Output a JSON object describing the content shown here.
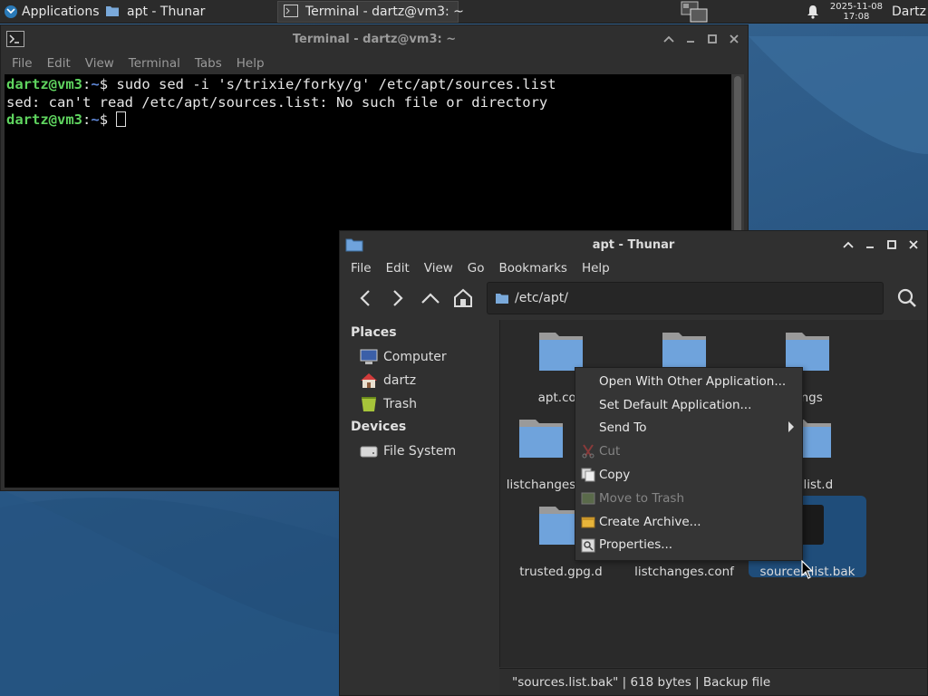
{
  "panel": {
    "applications_label": "Applications",
    "tasks": [
      {
        "label": "apt - Thunar"
      },
      {
        "label": "Terminal - dartz@vm3: ~"
      }
    ],
    "clock_date": "2025-11-08",
    "clock_time": "17:08",
    "user": "Dartz"
  },
  "terminal": {
    "title": "Terminal - dartz@vm3: ~",
    "menu": [
      "File",
      "Edit",
      "View",
      "Terminal",
      "Tabs",
      "Help"
    ],
    "lines": [
      {
        "user": "dartz@vm3",
        "sep": ":",
        "path": "~",
        "prompt": "$ ",
        "cmd": "sudo sed -i 's/trixie/forky/g' /etc/apt/sources.list"
      },
      {
        "output": "sed: can't read /etc/apt/sources.list: No such file or directory"
      },
      {
        "user": "dartz@vm3",
        "sep": ":",
        "path": "~",
        "prompt": "$ ",
        "cmd": ""
      }
    ]
  },
  "thunar": {
    "title": "apt - Thunar",
    "menu": [
      "File",
      "Edit",
      "View",
      "Go",
      "Bookmarks",
      "Help"
    ],
    "location": "/etc/apt/",
    "sidebar": {
      "places_header": "Places",
      "places": [
        {
          "label": "Computer",
          "icon": "computer-icon"
        },
        {
          "label": "dartz",
          "icon": "home-icon"
        },
        {
          "label": "Trash",
          "icon": "trash-icon"
        }
      ],
      "devices_header": "Devices",
      "devices": [
        {
          "label": "File System",
          "icon": "drive-icon"
        }
      ]
    },
    "files": [
      {
        "label": "apt.con"
      },
      {
        "label": ""
      },
      {
        "label": "rings"
      },
      {
        "label": "listchanges"
      },
      {
        "label": ""
      },
      {
        "label": "es.list.d"
      },
      {
        "label": "trusted.gpg.d"
      },
      {
        "label": "listchanges.conf"
      },
      {
        "label": "sources.list.bak"
      }
    ],
    "status": "\"sources.list.bak\"  |  618 bytes  |  Backup file"
  },
  "context_menu": {
    "items": [
      {
        "label": "Open With Other Application...",
        "enabled": true
      },
      {
        "label": "Set Default Application...",
        "enabled": true
      },
      {
        "label": "Send To",
        "enabled": true,
        "submenu": true
      },
      {
        "label": "Cut",
        "enabled": false,
        "icon": "scissors-icon"
      },
      {
        "label": "Copy",
        "enabled": true,
        "icon": "copy-icon"
      },
      {
        "label": "Move to Trash",
        "enabled": false,
        "icon": "trash-icon"
      },
      {
        "label": "Create Archive...",
        "enabled": true,
        "icon": "archive-icon"
      },
      {
        "label": "Properties...",
        "enabled": true,
        "icon": "properties-icon"
      }
    ]
  },
  "colors": {
    "prompt_user": "#5fd45f",
    "prompt_path": "#5f87d7",
    "selection": "#1f4d7a",
    "folder": "#6fa3dc"
  }
}
